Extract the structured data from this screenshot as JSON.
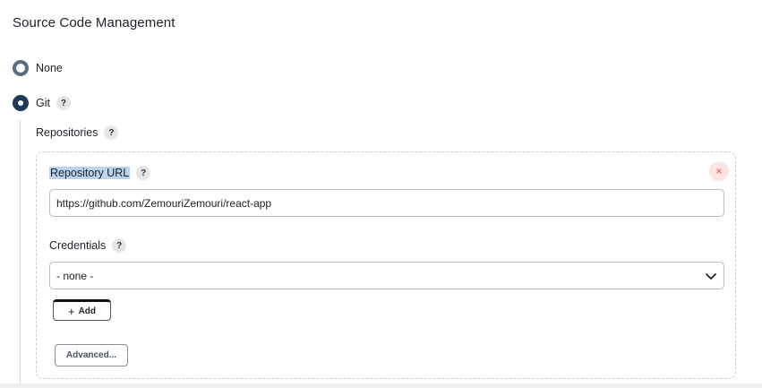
{
  "section": {
    "title": "Source Code Management"
  },
  "scm": {
    "none_label": "None",
    "git_label": "Git",
    "selected": "Git"
  },
  "help": {
    "symbol": "?"
  },
  "repositories": {
    "label": "Repositories",
    "repository_url": {
      "label": "Repository URL",
      "value": "https://github.com/ZemouriZemouri/react-app"
    },
    "credentials": {
      "label": "Credentials",
      "selected": "- none -"
    },
    "add_button": {
      "icon": "+",
      "label": "Add"
    },
    "advanced_button": {
      "label": "Advanced..."
    },
    "delete_icon": "×"
  }
}
